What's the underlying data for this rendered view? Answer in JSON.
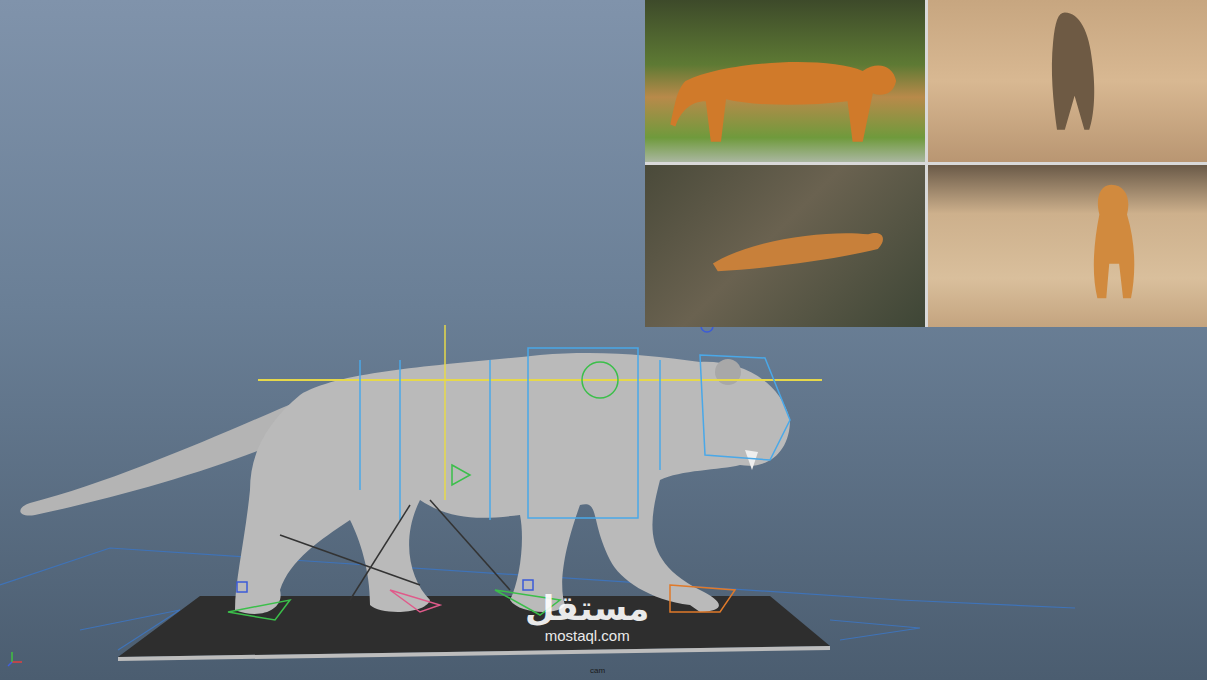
{
  "viewport": {
    "camera_label": "cam"
  },
  "watermark": {
    "logo": "مستقل",
    "url": "mostaql.com"
  }
}
